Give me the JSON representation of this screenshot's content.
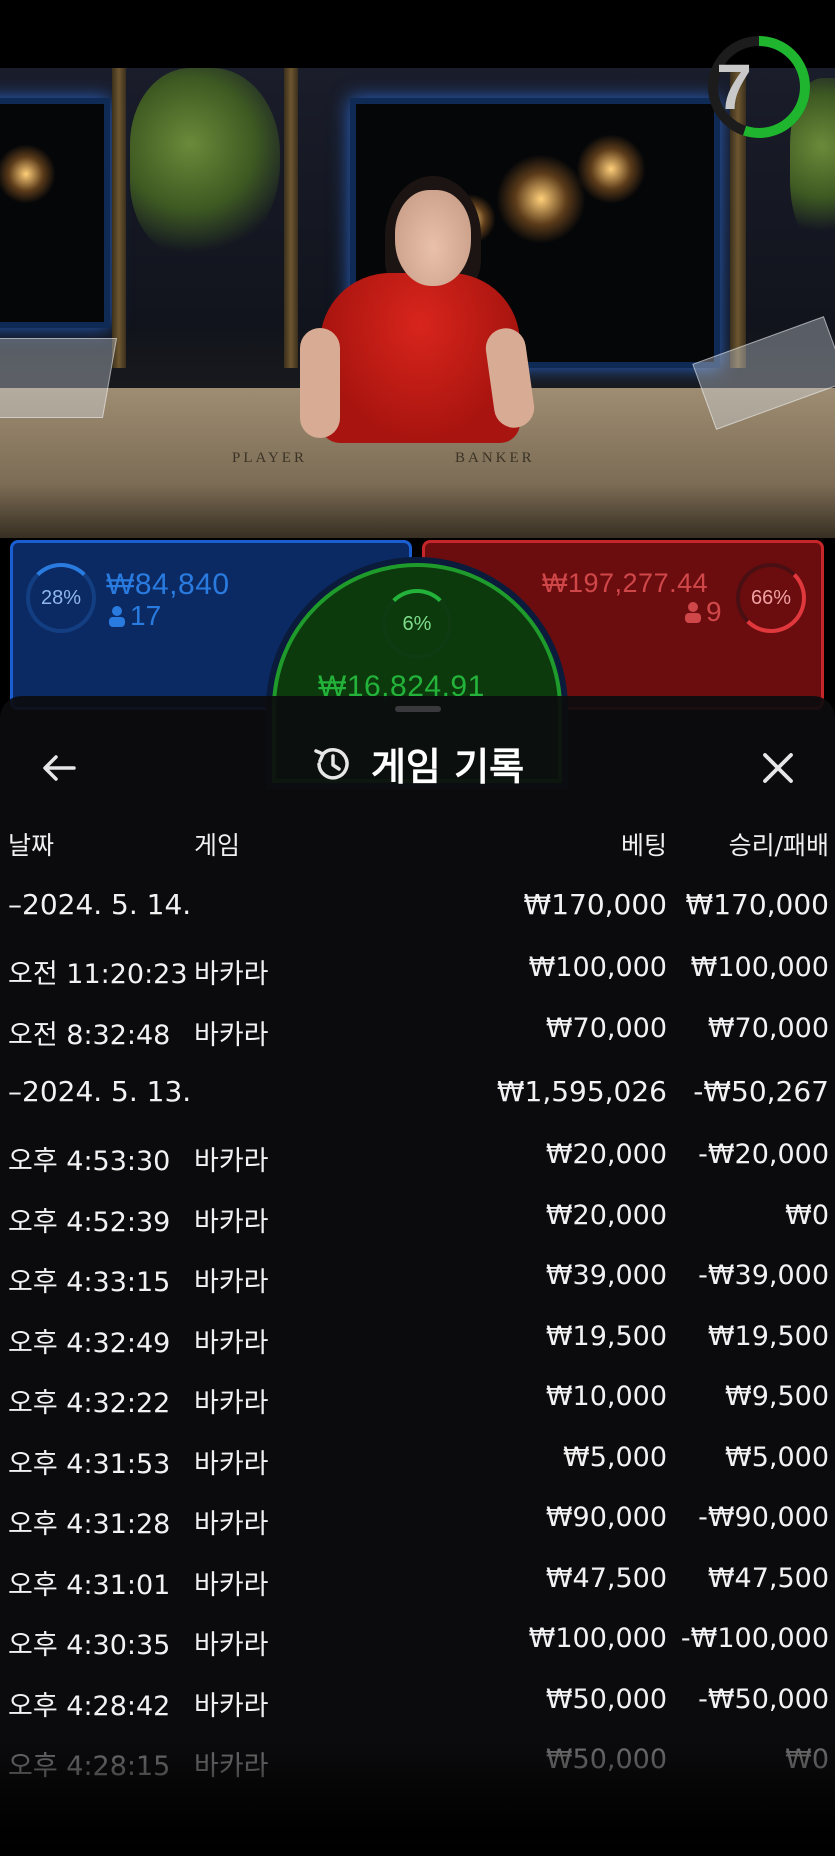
{
  "video": {
    "felt_player": "PLAYER",
    "felt_banker": "BANKER",
    "countdown": "7",
    "countdown_progress": 0.55
  },
  "bets": {
    "player": {
      "percent": "28%",
      "amount": "₩84,840",
      "players": "17",
      "color": "#2a7be0"
    },
    "banker": {
      "percent": "66%",
      "amount": "₩197,277.44",
      "players": "9",
      "color": "#e0383c"
    },
    "tie": {
      "percent": "6%",
      "amount": "₩16,824.91",
      "color": "#24b33a"
    }
  },
  "history": {
    "title": "게임 기록",
    "icons": {
      "back": "arrow-left-icon",
      "title": "history-icon",
      "close": "close-icon"
    },
    "columns": {
      "date": "날짜",
      "game": "게임",
      "bet": "베팅",
      "result": "승리/패배"
    },
    "rows": [
      {
        "kind": "date",
        "date": "–2024. 5. 14.",
        "game": "",
        "bet": "₩170,000",
        "result": "₩170,000"
      },
      {
        "kind": "game",
        "date": "오전 11:20:23",
        "game": "바카라",
        "bet": "₩100,000",
        "result": "₩100,000"
      },
      {
        "kind": "game",
        "date": "오전 8:32:48",
        "game": "바카라",
        "bet": "₩70,000",
        "result": "₩70,000"
      },
      {
        "kind": "date",
        "date": "–2024. 5. 13.",
        "game": "",
        "bet": "₩1,595,026",
        "result": "-₩50,267"
      },
      {
        "kind": "game",
        "date": "오후 4:53:30",
        "game": "바카라",
        "bet": "₩20,000",
        "result": "-₩20,000"
      },
      {
        "kind": "game",
        "date": "오후 4:52:39",
        "game": "바카라",
        "bet": "₩20,000",
        "result": "₩0"
      },
      {
        "kind": "game",
        "date": "오후 4:33:15",
        "game": "바카라",
        "bet": "₩39,000",
        "result": "-₩39,000"
      },
      {
        "kind": "game",
        "date": "오후 4:32:49",
        "game": "바카라",
        "bet": "₩19,500",
        "result": "₩19,500"
      },
      {
        "kind": "game",
        "date": "오후 4:32:22",
        "game": "바카라",
        "bet": "₩10,000",
        "result": "₩9,500"
      },
      {
        "kind": "game",
        "date": "오후 4:31:53",
        "game": "바카라",
        "bet": "₩5,000",
        "result": "₩5,000"
      },
      {
        "kind": "game",
        "date": "오후 4:31:28",
        "game": "바카라",
        "bet": "₩90,000",
        "result": "-₩90,000"
      },
      {
        "kind": "game",
        "date": "오후 4:31:01",
        "game": "바카라",
        "bet": "₩47,500",
        "result": "₩47,500"
      },
      {
        "kind": "game",
        "date": "오후 4:30:35",
        "game": "바카라",
        "bet": "₩100,000",
        "result": "-₩100,000"
      },
      {
        "kind": "game",
        "date": "오후 4:28:42",
        "game": "바카라",
        "bet": "₩50,000",
        "result": "-₩50,000"
      },
      {
        "kind": "game",
        "date": "오후 4:28:15",
        "game": "바카라",
        "bet": "₩50,000",
        "result": "₩0",
        "faded": true
      }
    ]
  }
}
